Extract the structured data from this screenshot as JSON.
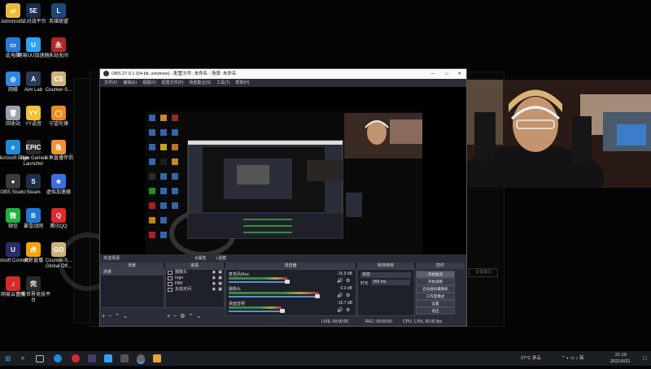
{
  "desktop_icons": [
    {
      "label": "Administr...",
      "color": "#e9b93b",
      "glyph": "📁"
    },
    {
      "label": "5E对战平台",
      "color": "#1d2a4d",
      "glyph": "5E"
    },
    {
      "label": "英雄联盟",
      "color": "#1b4a7a",
      "glyph": "L"
    },
    {
      "label": "此电脑",
      "color": "#2b7bd6",
      "glyph": "▭"
    },
    {
      "label": "网易UU加速器",
      "color": "#2fa2ff",
      "glyph": "U"
    },
    {
      "label": "永劫无间",
      "color": "#b02828",
      "glyph": "永"
    },
    {
      "label": "网络",
      "color": "#2f88e0",
      "glyph": "◎"
    },
    {
      "label": "Aim Lab",
      "color": "#2d3a55",
      "glyph": "A"
    },
    {
      "label": "Counter-S...",
      "color": "#cdb37a",
      "glyph": "CS"
    },
    {
      "label": "回收站",
      "color": "#9aa3ad",
      "glyph": "🗑"
    },
    {
      "label": "YY语音",
      "color": "#f2c230",
      "glyph": "YY"
    },
    {
      "label": "守望先锋",
      "color": "#ef8a22",
      "glyph": "◯"
    },
    {
      "label": "Microsoft Edge",
      "color": "#1f8ad6",
      "glyph": "e"
    },
    {
      "label": "Epic Games Launcher",
      "color": "#2a2a2a",
      "glyph": "EPIC"
    },
    {
      "label": "斗鱼直播伴侣",
      "color": "#f09030",
      "glyph": "鱼"
    },
    {
      "label": "OBS Studio",
      "color": "#3a3a3a",
      "glyph": "●"
    },
    {
      "label": "Steam",
      "color": "#1b2f4a",
      "glyph": "S"
    },
    {
      "label": "虚拟加速器",
      "color": "#3a6ee0",
      "glyph": "★"
    },
    {
      "label": "微信",
      "color": "#21b33b",
      "glyph": "微"
    },
    {
      "label": "暴雪战网",
      "color": "#1c7ad6",
      "glyph": "B"
    },
    {
      "label": "腾讯QQ",
      "color": "#e02b2b",
      "glyph": "Q"
    },
    {
      "label": "Ubisoft Connect",
      "color": "#2b2b6a",
      "glyph": "U"
    },
    {
      "label": "虎牙直播",
      "color": "#f5a300",
      "glyph": "虎"
    },
    {
      "label": "Counter-S... Global Off...",
      "color": "#cdb37a",
      "glyph": "GO"
    },
    {
      "label": "网易云音乐",
      "color": "#d62a2a",
      "glyph": "♫"
    },
    {
      "label": "完美世界竞技平台",
      "color": "#2a2a2a",
      "glyph": "完"
    }
  ],
  "obs": {
    "title": "OBS 27.0.1 (64-bit, windows) - 配置文件: 未命名 - 场景: 未命名",
    "menu": [
      "文件(F)",
      "编辑(E)",
      "视图(V)",
      "配置文件(P)",
      "场景集合(S)",
      "工具(T)",
      "帮助(H)"
    ],
    "source_bar": "未选择源",
    "source_buttons": [
      "属性",
      "滤镜"
    ],
    "scenes_header": "场景",
    "scenes": [
      "场景"
    ],
    "sources_header": "来源",
    "sources": [
      "摄像头",
      "rugo",
      "FBK",
      "永劫无间"
    ],
    "mixer_header": "混音器",
    "mixer": [
      {
        "name": "麦克风/Aux",
        "db": "-15.9 dB",
        "level": 0.55
      },
      {
        "name": "摄像头",
        "db": "0.0 dB",
        "level": 0.85
      },
      {
        "name": "桌面音频",
        "db": "-16.7 dB",
        "level": 0.5
      }
    ],
    "transitions_header": "转场特效",
    "transition_select": "渐变",
    "duration_label": "时长",
    "duration_value": "300 ms",
    "controls_header": "控件",
    "controls": [
      "开始推流",
      "开始录制",
      "启动虚拟摄像机",
      "工作室模式",
      "设置",
      "退出"
    ],
    "status": {
      "live": "LIVE: 00:00:00",
      "rec": "REC: 00:00:00",
      "cpu": "CPU: 1.5%, 60.00 fps"
    }
  },
  "ghost_button": "设置模式",
  "taskbar": {
    "weather": "27°C 多云",
    "time": "21:19",
    "date": "2021/6/21"
  }
}
